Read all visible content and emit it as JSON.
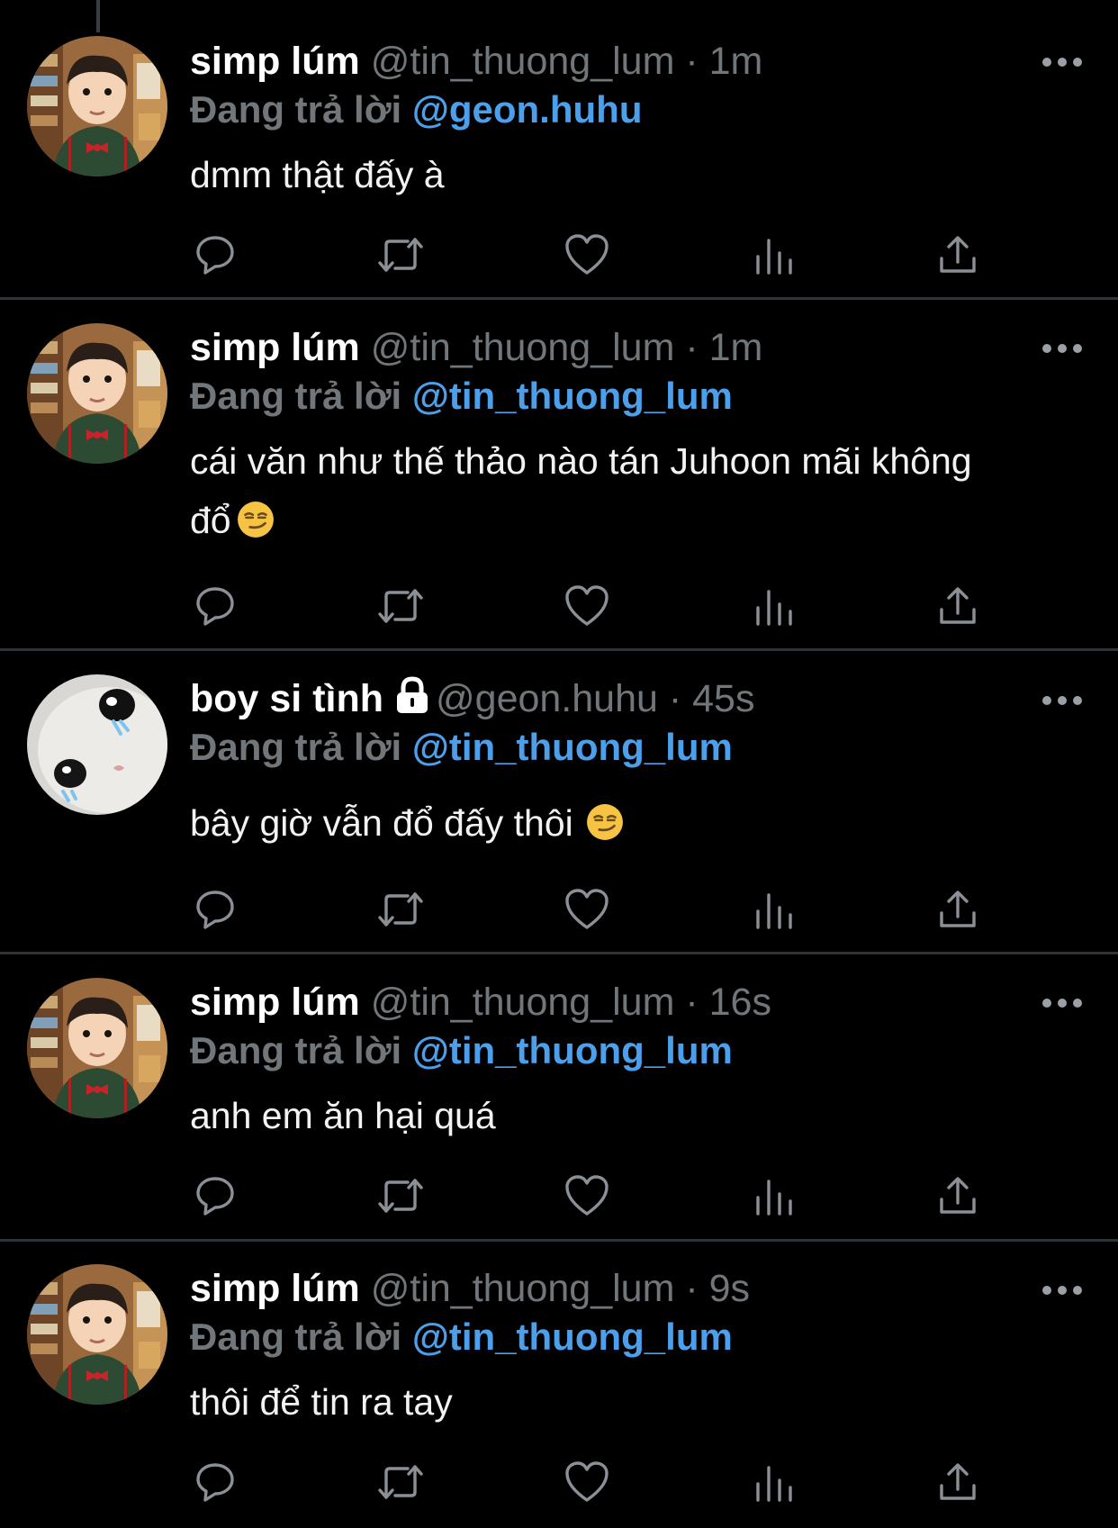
{
  "colors": {
    "background": "#000000",
    "mention": "#4ca0eb",
    "meta": "#71767b",
    "divider": "#2f3336"
  },
  "icons": [
    "reply-icon",
    "retweet-icon",
    "like-icon",
    "views-icon",
    "share-icon",
    "more-icon",
    "lock-icon",
    "smirk-emoji"
  ],
  "tweets": [
    {
      "name": "simp lúm",
      "meta": "@tin_thuong_lum · 1m",
      "reply_label": "Đang trả lời",
      "reply_to": "@geon.huhu",
      "text": "dmm thật đấy à"
    },
    {
      "name": "simp lúm",
      "meta": "@tin_thuong_lum · 1m",
      "reply_label": "Đang trả lời",
      "reply_to": "@tin_thuong_lum",
      "text": "cái văn như thế thảo nào tán Juhoon mãi không đổ"
    },
    {
      "name": "boy si tình",
      "meta": "@geon.huhu · 45s",
      "reply_label": "Đang trả lời",
      "reply_to": "@tin_thuong_lum",
      "text": "bây giờ vẫn đổ đấy thôi"
    },
    {
      "name": "simp lúm",
      "meta": "@tin_thuong_lum · 16s",
      "reply_label": "Đang trả lời",
      "reply_to": "@tin_thuong_lum",
      "text": "anh em ăn hại quá"
    },
    {
      "name": "simp lúm",
      "meta": "@tin_thuong_lum · 9s",
      "reply_label": "Đang trả lời",
      "reply_to": "@tin_thuong_lum",
      "text": "thôi để tin ra tay"
    }
  ]
}
